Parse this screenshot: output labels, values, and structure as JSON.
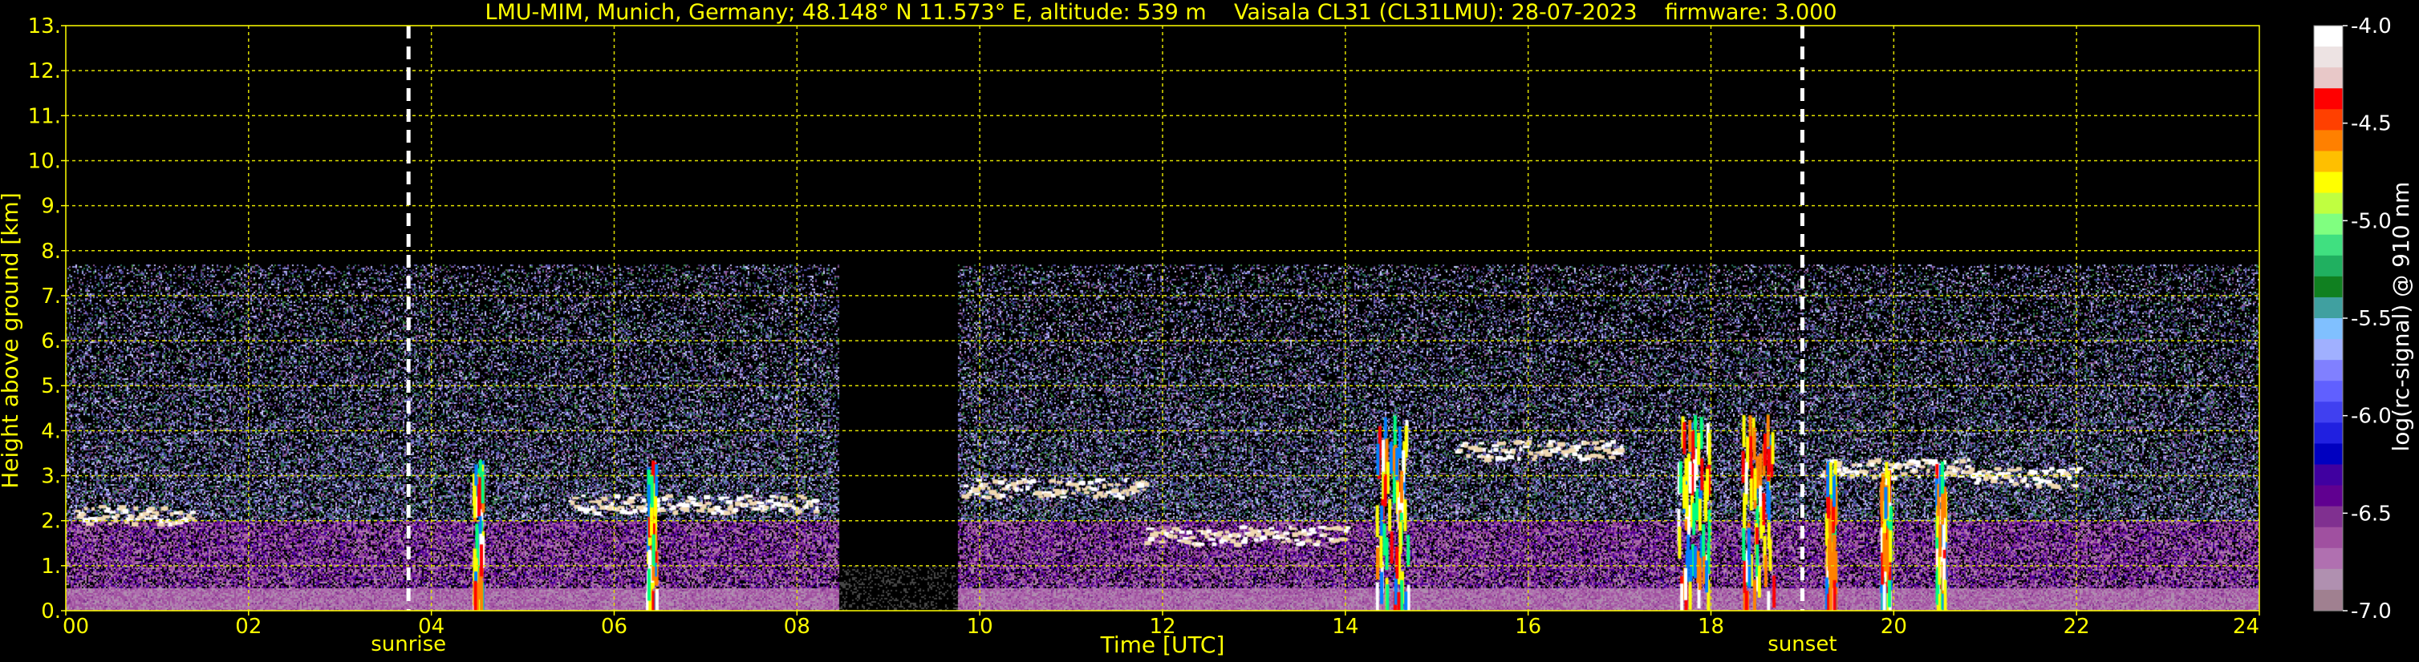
{
  "chart_data": {
    "type": "heatmap",
    "title": "LMU-MIM, Munich, Germany; 48.148° N 11.573° E, altitude: 539 m    Vaisala CL31 (CL31LMU): 28-07-2023    firmware: 3.000",
    "xlabel": "Time [UTC]",
    "ylabel": "Height above ground [km]",
    "xlim": [
      0,
      24
    ],
    "ylim": [
      0,
      13
    ],
    "x_ticks": [
      0,
      2,
      4,
      6,
      8,
      10,
      12,
      14,
      16,
      18,
      20,
      22,
      24
    ],
    "x_tick_labels": [
      "00",
      "02",
      "04",
      "06",
      "08",
      "10",
      "12",
      "14",
      "16",
      "18",
      "20",
      "22",
      "24"
    ],
    "y_ticks": [
      0,
      1,
      2,
      3,
      4,
      5,
      6,
      7,
      8,
      9,
      10,
      11,
      12,
      13
    ],
    "y_tick_labels": [
      "0.",
      "1.",
      "2.",
      "3.",
      "4.",
      "5.",
      "6.",
      "7.",
      "8.",
      "9.",
      "10.",
      "11.",
      "12.",
      "13."
    ],
    "grid": true,
    "sunrise": {
      "time": 3.75,
      "label": "sunrise"
    },
    "sunset": {
      "time": 19.0,
      "label": "sunset"
    },
    "data_top_km": 7.7,
    "data_gap_hours": [
      8.45,
      9.75
    ],
    "features": {
      "surface_aerosol_layer_km": [
        0,
        0.5
      ],
      "residual_layer_km": [
        0.5,
        2.0
      ],
      "cloud_layer_segments": [
        {
          "t": [
            0.1,
            1.4
          ],
          "h": 2.15
        },
        {
          "t": [
            5.5,
            8.2
          ],
          "h": 2.4
        },
        {
          "t": [
            9.8,
            11.8
          ],
          "h": 2.75
        },
        {
          "t": [
            11.8,
            14.0
          ],
          "h": 1.7
        },
        {
          "t": [
            15.2,
            17.0
          ],
          "h": 3.6
        },
        {
          "t": [
            19.2,
            20.8
          ],
          "h": 3.2
        },
        {
          "t": [
            20.8,
            22.0
          ],
          "h": 3.0
        }
      ],
      "precipitation_shafts_hours": [
        4.5,
        6.4,
        14.5,
        17.8,
        18.5,
        19.3,
        19.9,
        20.5
      ]
    },
    "colorbar": {
      "label": "log(rc-signal) @ 910 nm",
      "min": -7.0,
      "max": -4.0,
      "ticks": [
        -4.0,
        -4.5,
        -5.0,
        -5.5,
        -6.0,
        -6.5,
        -7.0
      ],
      "tick_labels": [
        "-4.0",
        "-4.5",
        "-5.0",
        "-5.5",
        "-6.0",
        "-6.5",
        "-7.0"
      ],
      "colors": [
        "#ffffff",
        "#ede3e3",
        "#e8c8c8",
        "#ff0000",
        "#ff4000",
        "#ff8000",
        "#ffbf00",
        "#ffff00",
        "#c0ff40",
        "#80ff80",
        "#40e080",
        "#20b060",
        "#108020",
        "#40a0a0",
        "#80c0ff",
        "#a0b0ff",
        "#8080ff",
        "#6060ff",
        "#4040f0",
        "#2020e0",
        "#0000c0",
        "#4000a0",
        "#600090",
        "#803090",
        "#a050a0",
        "#b070b0",
        "#b090b0",
        "#a08090"
      ]
    }
  }
}
